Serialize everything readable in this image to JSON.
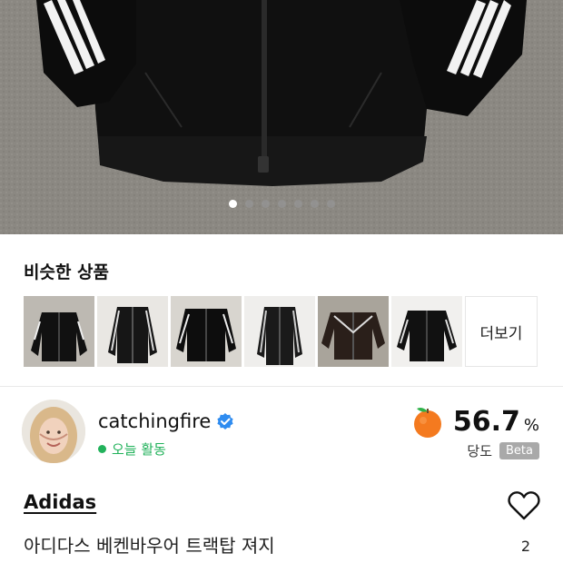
{
  "gallery": {
    "image_alt": "Black Adidas track jacket with white three stripes",
    "dot_count": 7,
    "active_index": 0
  },
  "similar": {
    "title": "비슷한 상품",
    "more_label": "더보기",
    "items": [
      {
        "name": "similar-item-1"
      },
      {
        "name": "similar-item-2"
      },
      {
        "name": "similar-item-3"
      },
      {
        "name": "similar-item-4"
      },
      {
        "name": "similar-item-5"
      },
      {
        "name": "similar-item-6"
      }
    ]
  },
  "seller": {
    "name": "catchingfire",
    "activity": "오늘 활동",
    "score": "56.7",
    "score_unit": "%",
    "score_label": "당도",
    "beta": "Beta",
    "verified_icon": "verified-badge-icon",
    "score_icon": "orange-fruit-icon"
  },
  "product": {
    "brand": "Adidas",
    "title": "아디다스 베켄바우어 트랙탑 져지",
    "likes": "2"
  },
  "colors": {
    "accent_green": "#22b25b",
    "verified_blue": "#2f8cf0",
    "orange": "#f47a1f"
  }
}
